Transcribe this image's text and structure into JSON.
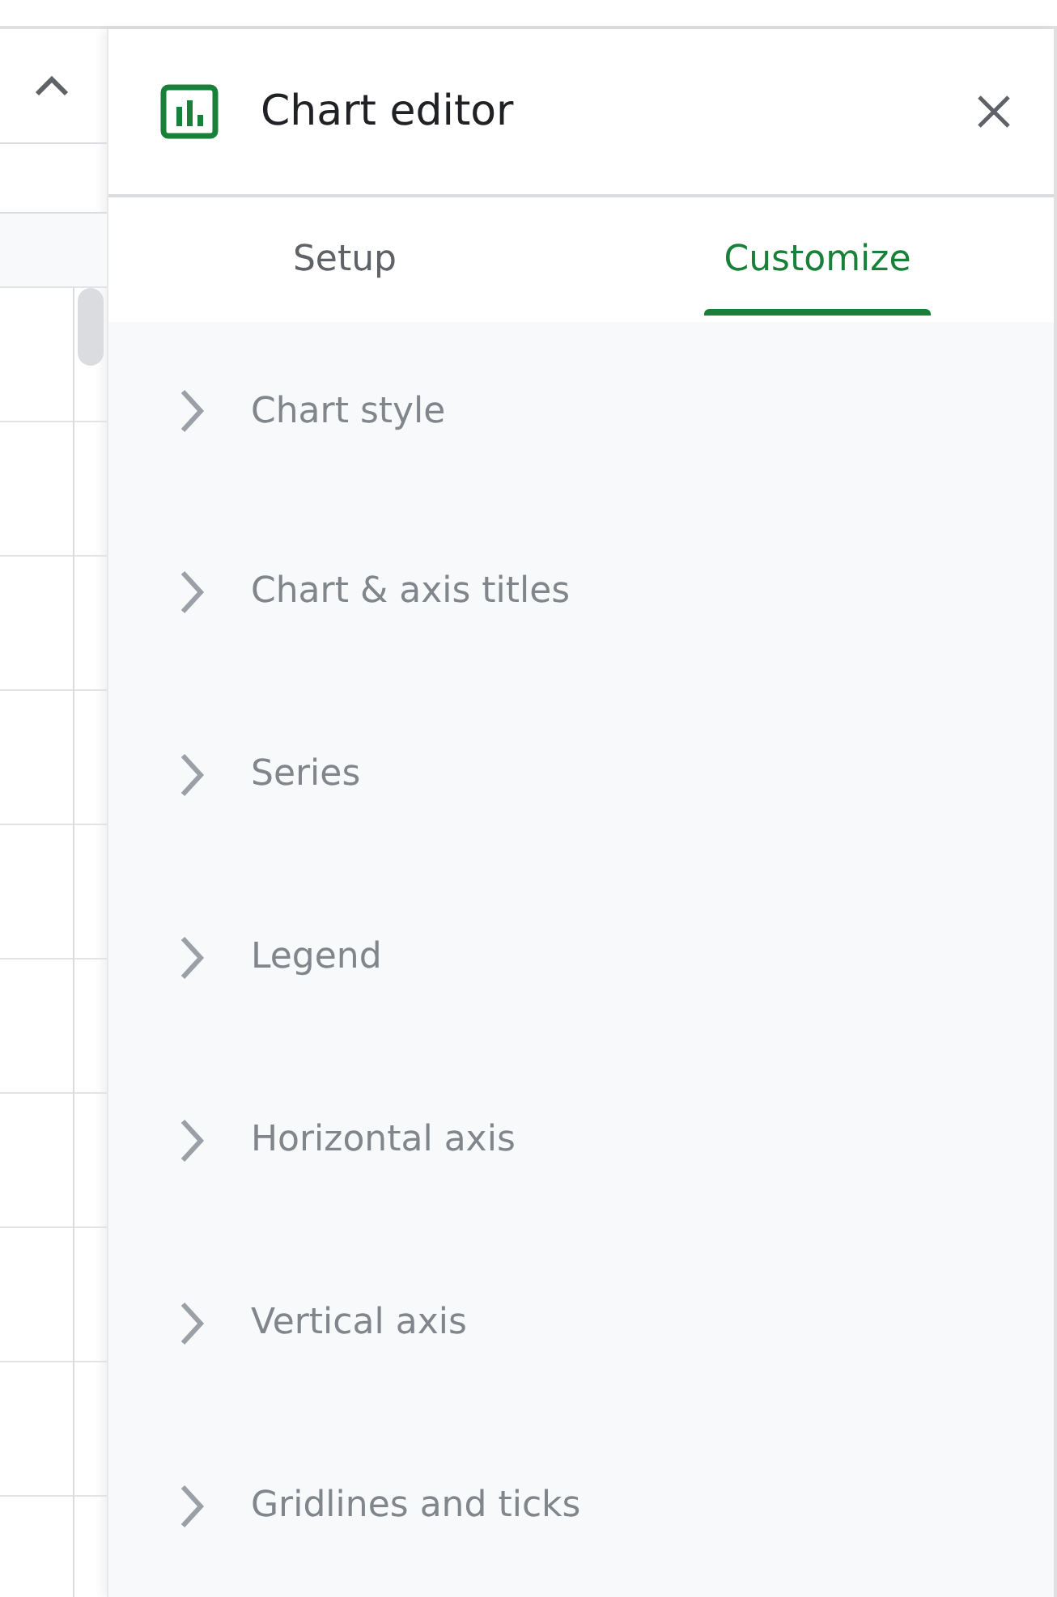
{
  "panel": {
    "title": "Chart editor"
  },
  "tabs": [
    {
      "label": "Setup",
      "selected": false
    },
    {
      "label": "Customize",
      "selected": true
    }
  ],
  "sections": [
    {
      "label": "Chart style",
      "expanded": false
    },
    {
      "label": "Chart & axis titles",
      "expanded": false
    },
    {
      "label": "Series",
      "expanded": false
    },
    {
      "label": "Legend",
      "expanded": false
    },
    {
      "label": "Horizontal axis",
      "expanded": false
    },
    {
      "label": "Vertical axis",
      "expanded": false
    },
    {
      "label": "Gridlines and ticks",
      "expanded": false
    }
  ]
}
